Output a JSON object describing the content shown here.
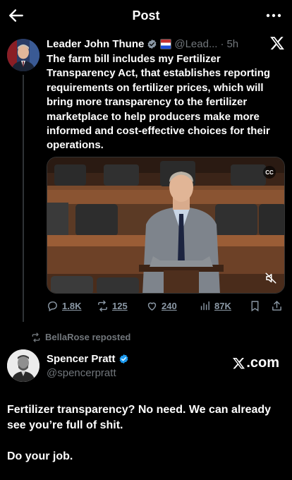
{
  "header": {
    "title": "Post"
  },
  "tweet": {
    "author_name": "Leader John Thune",
    "handle": "@Lead...",
    "separator": "·",
    "time": "5h",
    "text": "The farm bill includes my Fertilizer Transparency Act, that establishes reporting requirements on fertilizer prices, which will bring more transparency to the fertilizer marketplace to help producers make more informed and cost-effective choices for their operations.",
    "media": {
      "cc_label": "CC"
    },
    "stats": {
      "replies": "1.8K",
      "reposts": "125",
      "likes": "240",
      "views": "87K"
    }
  },
  "repost_banner": {
    "text": "BellaRose reposted"
  },
  "reply": {
    "author_name": "Spencer Pratt",
    "handle": "@spencerpratt",
    "watermark_suffix": ".com",
    "text_p1": "Fertilizer transparency? No need. We can already see you’re full of shit.",
    "text_p2": "Do your job."
  },
  "colors": {
    "background": "#000000",
    "text": "#e7e9ea",
    "muted": "#71767b",
    "verified_blue": "#1d9bf0",
    "verified_gold": "#e8b829"
  }
}
